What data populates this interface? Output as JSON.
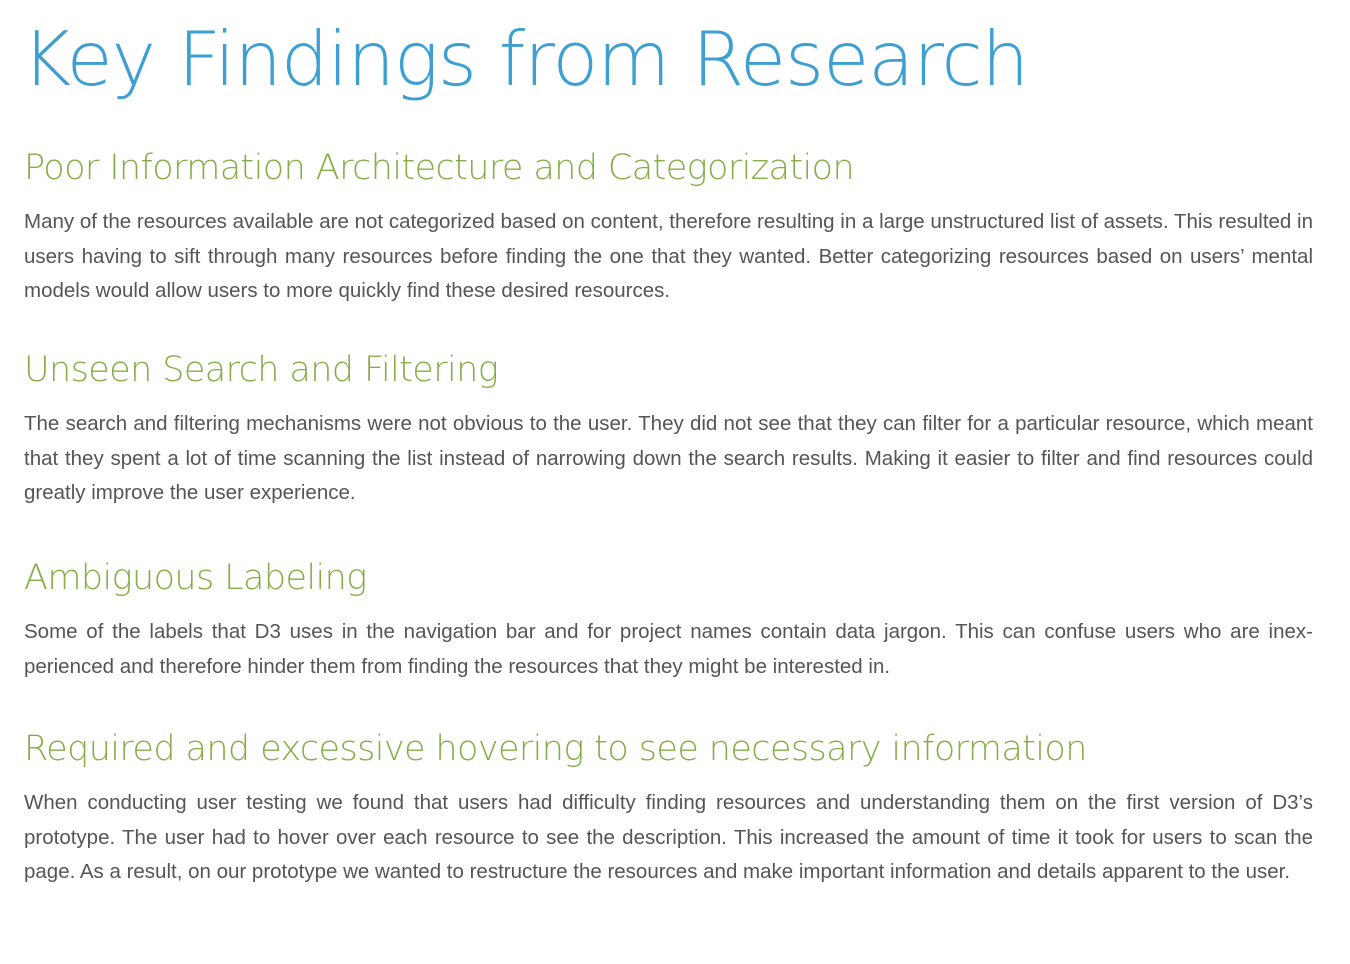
{
  "page": {
    "title": "Key Findings from Research"
  },
  "colors": {
    "title": "#3ea0d2",
    "heading": "#86ad48",
    "body": "#555555",
    "background": "#ffffff"
  },
  "sections": [
    {
      "heading": "Poor Information Architecture and Categorization",
      "body": "Many of the resources available are not categorized based on content, therefore resulting in a large unstructured list of assets. This resulted in users having to sift through many resources before finding the one that they wanted. Better categorizing resources based on users’ mental models would allow users to more quickly find these desired resources."
    },
    {
      "heading": "Unseen Search and Filtering",
      "body": "The search and filtering mechanisms were not obvious to the user. They did not see that they can filter for a particular resource, which meant that they spent a lot of time scanning the list instead of narrowing down the search results. Making it easier to filter and find resources could greatly improve the user experience."
    },
    {
      "heading": "Ambiguous Labeling",
      "body": "Some of the labels that D3 uses in the navigation bar and for project names contain data jargon. This can confuse users who are inex-perienced and therefore hinder them from finding the resources that they might be interested in."
    },
    {
      "heading": "Required and excessive hovering to see necessary information",
      "body": "When conducting user testing we found that users had difficulty finding resources and understanding them on the first version of D3’s prototype. The user had to hover over each resource to see the description. This increased the amount of time it took for users to scan the page. As a result, on our prototype we wanted to restructure the resources and make important information and details apparent to the user."
    }
  ]
}
